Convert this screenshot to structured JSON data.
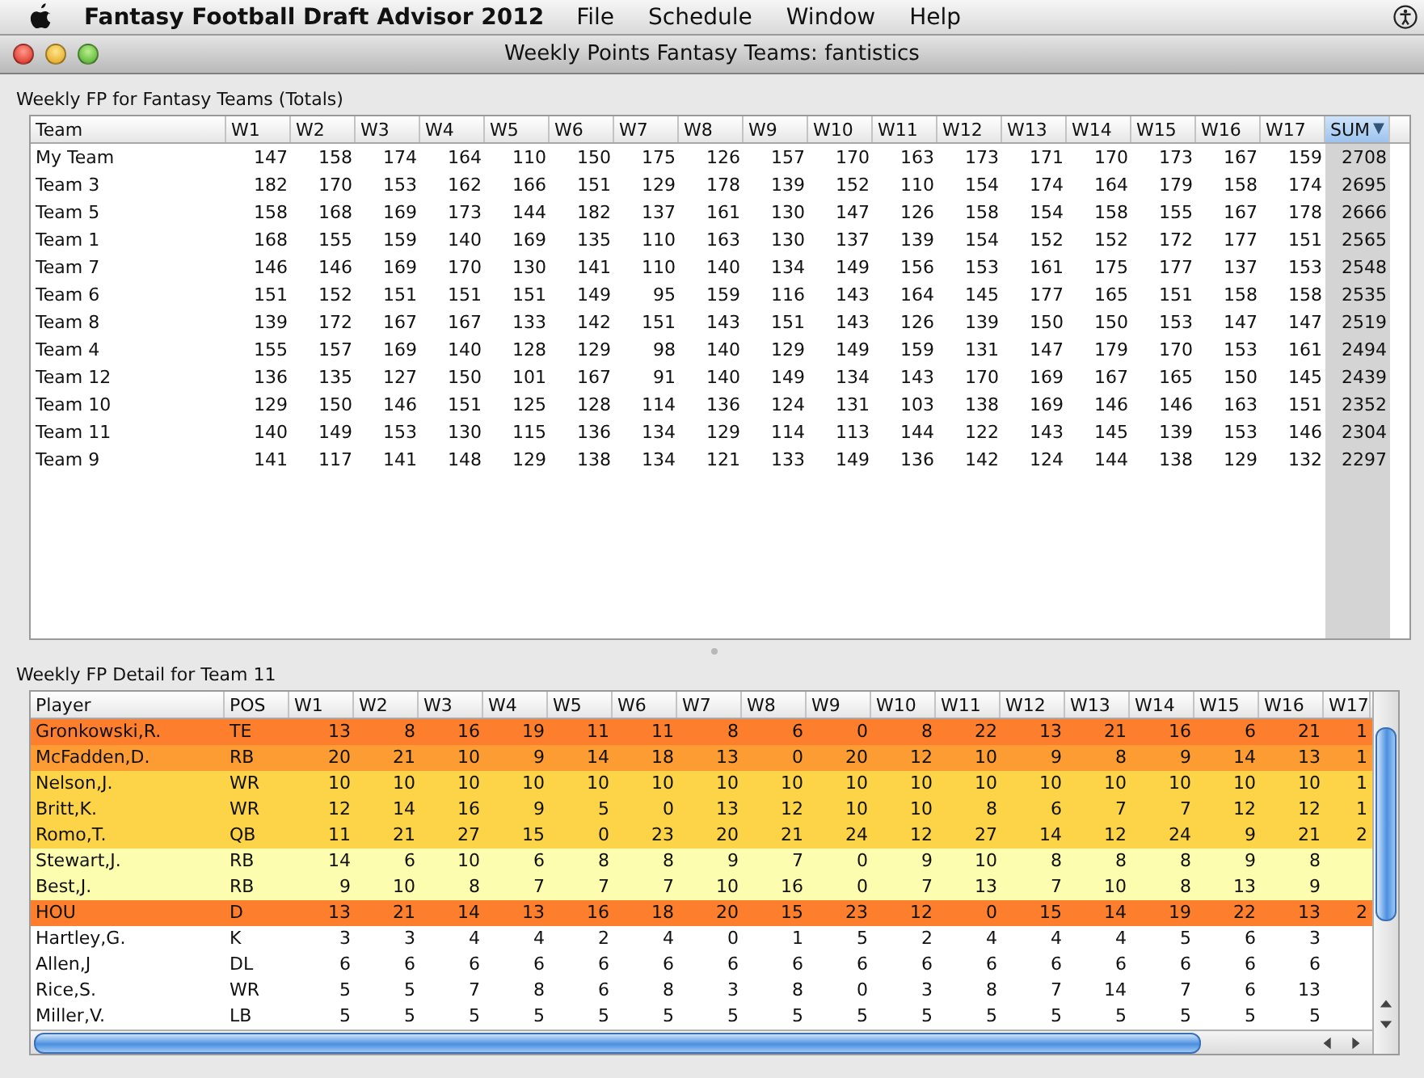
{
  "menu_bar": {
    "app_name": "Fantasy Football Draft Advisor 2012",
    "items": [
      "File",
      "Schedule",
      "Window",
      "Help"
    ]
  },
  "window": {
    "title": "Weekly Points Fantasy Teams: fantistics"
  },
  "totals_panel": {
    "title": "Weekly FP for Fantasy Teams (Totals)",
    "sort_indicator": "▼",
    "columns": [
      {
        "label": "Team",
        "selected": false
      },
      {
        "label": "W1",
        "selected": false
      },
      {
        "label": "W2",
        "selected": false
      },
      {
        "label": "W3",
        "selected": false
      },
      {
        "label": "W4",
        "selected": false
      },
      {
        "label": "W5",
        "selected": false
      },
      {
        "label": "W6",
        "selected": false
      },
      {
        "label": "W7",
        "selected": false
      },
      {
        "label": "W8",
        "selected": false
      },
      {
        "label": "W9",
        "selected": false
      },
      {
        "label": "W10",
        "selected": false
      },
      {
        "label": "W11",
        "selected": false
      },
      {
        "label": "W12",
        "selected": false
      },
      {
        "label": "W13",
        "selected": false
      },
      {
        "label": "W14",
        "selected": false
      },
      {
        "label": "W15",
        "selected": false
      },
      {
        "label": "W16",
        "selected": false
      },
      {
        "label": "W17",
        "selected": false
      },
      {
        "label": "SUM",
        "selected": true
      }
    ],
    "rows": [
      {
        "team": "My Team",
        "values": [
          "147",
          "158",
          "174",
          "164",
          "110",
          "150",
          "175",
          "126",
          "157",
          "170",
          "163",
          "173",
          "171",
          "170",
          "173",
          "167",
          "159",
          "2708"
        ]
      },
      {
        "team": "Team 3",
        "values": [
          "182",
          "170",
          "153",
          "162",
          "166",
          "151",
          "129",
          "178",
          "139",
          "152",
          "110",
          "154",
          "174",
          "164",
          "179",
          "158",
          "174",
          "2695"
        ]
      },
      {
        "team": "Team 5",
        "values": [
          "158",
          "168",
          "169",
          "173",
          "144",
          "182",
          "137",
          "161",
          "130",
          "147",
          "126",
          "158",
          "154",
          "158",
          "155",
          "167",
          "178",
          "2666"
        ]
      },
      {
        "team": "Team 1",
        "values": [
          "168",
          "155",
          "159",
          "140",
          "169",
          "135",
          "110",
          "163",
          "130",
          "137",
          "139",
          "154",
          "152",
          "152",
          "172",
          "177",
          "151",
          "2565"
        ]
      },
      {
        "team": "Team 7",
        "values": [
          "146",
          "146",
          "169",
          "170",
          "130",
          "141",
          "110",
          "140",
          "134",
          "149",
          "156",
          "153",
          "161",
          "175",
          "177",
          "137",
          "153",
          "2548"
        ]
      },
      {
        "team": "Team 6",
        "values": [
          "151",
          "152",
          "151",
          "151",
          "151",
          "149",
          "95",
          "159",
          "116",
          "143",
          "164",
          "145",
          "177",
          "165",
          "151",
          "158",
          "158",
          "2535"
        ]
      },
      {
        "team": "Team 8",
        "values": [
          "139",
          "172",
          "167",
          "167",
          "133",
          "142",
          "151",
          "143",
          "151",
          "143",
          "126",
          "139",
          "150",
          "150",
          "153",
          "147",
          "147",
          "2519"
        ]
      },
      {
        "team": "Team 4",
        "values": [
          "155",
          "157",
          "169",
          "140",
          "128",
          "129",
          "98",
          "140",
          "129",
          "149",
          "159",
          "131",
          "147",
          "179",
          "170",
          "153",
          "161",
          "2494"
        ]
      },
      {
        "team": "Team 12",
        "values": [
          "136",
          "135",
          "127",
          "150",
          "101",
          "167",
          "91",
          "140",
          "149",
          "134",
          "143",
          "170",
          "169",
          "167",
          "165",
          "150",
          "145",
          "2439"
        ]
      },
      {
        "team": "Team 10",
        "values": [
          "129",
          "150",
          "146",
          "151",
          "125",
          "128",
          "114",
          "136",
          "124",
          "131",
          "103",
          "138",
          "169",
          "146",
          "146",
          "163",
          "151",
          "2352"
        ]
      },
      {
        "team": "Team 11",
        "values": [
          "140",
          "149",
          "153",
          "130",
          "115",
          "136",
          "134",
          "129",
          "114",
          "113",
          "144",
          "122",
          "143",
          "145",
          "139",
          "153",
          "146",
          "2304"
        ]
      },
      {
        "team": "Team 9",
        "values": [
          "141",
          "117",
          "141",
          "148",
          "129",
          "138",
          "134",
          "121",
          "133",
          "149",
          "136",
          "142",
          "124",
          "144",
          "138",
          "129",
          "132",
          "2297"
        ]
      }
    ]
  },
  "detail_panel": {
    "title": "Weekly FP Detail for Team 11",
    "columns": [
      "Player",
      "POS",
      "W1",
      "W2",
      "W3",
      "W4",
      "W5",
      "W6",
      "W7",
      "W8",
      "W9",
      "W10",
      "W11",
      "W12",
      "W13",
      "W14",
      "W15",
      "W16",
      "W17"
    ],
    "rows": [
      {
        "player": "Gronkowski,R.",
        "pos": "TE",
        "color": "#fd7e2c",
        "values": [
          "13",
          "8",
          "16",
          "19",
          "11",
          "11",
          "8",
          "6",
          "0",
          "8",
          "22",
          "13",
          "21",
          "16",
          "6",
          "21",
          "1"
        ]
      },
      {
        "player": "McFadden,D.",
        "pos": "RB",
        "color": "#fd9c32",
        "values": [
          "20",
          "21",
          "10",
          "9",
          "14",
          "18",
          "13",
          "0",
          "20",
          "12",
          "10",
          "9",
          "8",
          "9",
          "14",
          "13",
          "1"
        ]
      },
      {
        "player": "Nelson,J.",
        "pos": "WR",
        "color": "#fdd348",
        "values": [
          "10",
          "10",
          "10",
          "10",
          "10",
          "10",
          "10",
          "10",
          "10",
          "10",
          "10",
          "10",
          "10",
          "10",
          "10",
          "10",
          "1"
        ]
      },
      {
        "player": "Britt,K.",
        "pos": "WR",
        "color": "#fdd348",
        "values": [
          "12",
          "14",
          "16",
          "9",
          "5",
          "0",
          "13",
          "12",
          "10",
          "10",
          "8",
          "6",
          "7",
          "7",
          "12",
          "12",
          "1"
        ]
      },
      {
        "player": "Romo,T.",
        "pos": "QB",
        "color": "#fdd348",
        "values": [
          "11",
          "21",
          "27",
          "15",
          "0",
          "23",
          "20",
          "21",
          "24",
          "12",
          "27",
          "14",
          "12",
          "24",
          "9",
          "21",
          "2"
        ]
      },
      {
        "player": "Stewart,J.",
        "pos": "RB",
        "color": "#fdfdb0",
        "values": [
          "14",
          "6",
          "10",
          "6",
          "8",
          "8",
          "9",
          "7",
          "0",
          "9",
          "10",
          "8",
          "8",
          "8",
          "9",
          "8"
        ]
      },
      {
        "player": "Best,J.",
        "pos": "RB",
        "color": "#fdfdb0",
        "values": [
          "9",
          "10",
          "8",
          "7",
          "7",
          "7",
          "10",
          "16",
          "0",
          "7",
          "13",
          "7",
          "10",
          "8",
          "13",
          "9"
        ]
      },
      {
        "player": "HOU",
        "pos": "D",
        "color": "#fd7e2c",
        "values": [
          "13",
          "21",
          "14",
          "13",
          "16",
          "18",
          "20",
          "15",
          "23",
          "12",
          "0",
          "15",
          "14",
          "19",
          "22",
          "13",
          "2"
        ]
      },
      {
        "player": "Hartley,G.",
        "pos": "K",
        "color": "#ffffff",
        "values": [
          "3",
          "3",
          "4",
          "4",
          "2",
          "4",
          "0",
          "1",
          "5",
          "2",
          "4",
          "4",
          "4",
          "5",
          "6",
          "3"
        ]
      },
      {
        "player": "Allen,J",
        "pos": "DL",
        "color": "#ffffff",
        "values": [
          "6",
          "6",
          "6",
          "6",
          "6",
          "6",
          "6",
          "6",
          "6",
          "6",
          "6",
          "6",
          "6",
          "6",
          "6",
          "6"
        ]
      },
      {
        "player": "Rice,S.",
        "pos": "WR",
        "color": "#ffffff",
        "values": [
          "5",
          "5",
          "7",
          "8",
          "6",
          "8",
          "3",
          "8",
          "0",
          "3",
          "8",
          "7",
          "14",
          "7",
          "6",
          "13"
        ]
      },
      {
        "player": "Miller,V.",
        "pos": "LB",
        "color": "#ffffff",
        "values": [
          "5",
          "5",
          "5",
          "5",
          "5",
          "5",
          "5",
          "5",
          "5",
          "5",
          "5",
          "5",
          "5",
          "5",
          "5",
          "5"
        ]
      }
    ]
  }
}
